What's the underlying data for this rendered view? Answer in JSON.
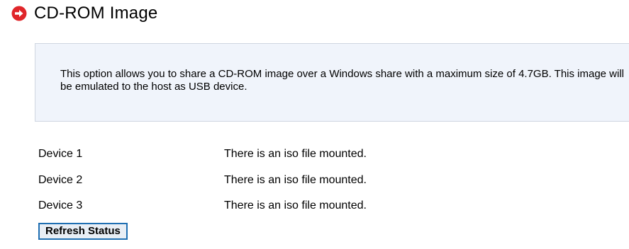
{
  "header": {
    "title": "CD-ROM Image",
    "icon": "red-circle-arrow-icon",
    "icon_color": "#e0262a"
  },
  "info": {
    "text": "This option allows you to share a CD-ROM image over a Windows share with a maximum size of 4.7GB. This image will be emulated to the host as USB device."
  },
  "devices": [
    {
      "label": "Device 1",
      "status": "There is an iso file mounted."
    },
    {
      "label": "Device 2",
      "status": "There is an iso file mounted."
    },
    {
      "label": "Device 3",
      "status": "There is an iso file mounted."
    }
  ],
  "actions": {
    "refresh_label": "Refresh Status"
  },
  "colors": {
    "info_background": "#f0f4fb",
    "button_border": "#1f6fb2"
  }
}
